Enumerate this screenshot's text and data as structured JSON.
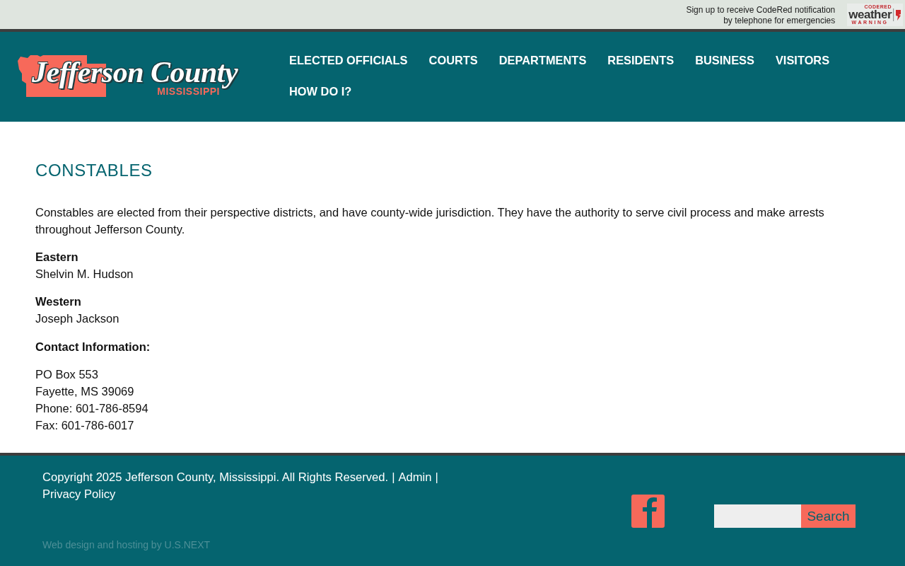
{
  "top_bar": {
    "notice_lines": [
      "Sign up to receive CodeRed notification",
      "by telephone for emergencies"
    ],
    "badge": {
      "small_label": "CODERED",
      "title": "weather",
      "subtitle": "WARNING"
    }
  },
  "header": {
    "logo": {
      "title": "Jefferson County",
      "subtitle": "MISSISSIPPI"
    },
    "nav": [
      {
        "label": "ELECTED OFFICIALS"
      },
      {
        "label": "COURTS"
      },
      {
        "label": "DEPARTMENTS"
      },
      {
        "label": "RESIDENTS"
      },
      {
        "label": "BUSINESS"
      },
      {
        "label": "VISITORS"
      },
      {
        "label": "HOW DO I?"
      }
    ]
  },
  "page": {
    "heading": "CONSTABLES",
    "intro": "Constables are elected from their perspective districts, and have county-wide jurisdiction. They have the authority to serve civil process and make arrests throughout Jefferson County.",
    "districts": [
      {
        "name": "Eastern",
        "person": "Shelvin M. Hudson"
      },
      {
        "name": "Western",
        "person": "Joseph Jackson"
      }
    ],
    "contact_heading": "Contact Information:",
    "contact_lines": [
      "PO Box 553",
      "Fayette, MS 39069",
      "Phone: 601-786-8594",
      "Fax: 601-786-6017"
    ]
  },
  "footer": {
    "copyright": "Copyright 2025 Jefferson County, Mississippi. All Rights Reserved.",
    "links": [
      {
        "label": "Admin",
        "separator": "|"
      },
      {
        "label": "Privacy Policy",
        "separator": "|"
      }
    ],
    "credit": "Web design and hosting by U.S.NEXT",
    "search": {
      "button": "Search"
    }
  }
}
